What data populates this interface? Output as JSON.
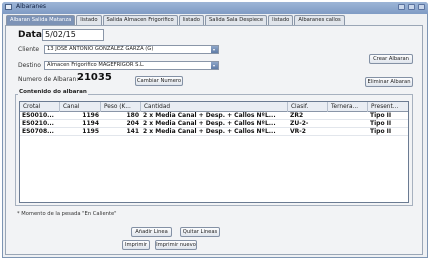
{
  "window": {
    "title": "Albaranes"
  },
  "tabs": [
    {
      "label": "Albaran Salida Matanza"
    },
    {
      "label": "listado"
    },
    {
      "label": "Salida Almacen Frigorifico"
    },
    {
      "label": "listado"
    },
    {
      "label": "Salida Sala Despiece"
    },
    {
      "label": "listado"
    },
    {
      "label": "Albaranes callos"
    }
  ],
  "form": {
    "fecha_label": "Data",
    "fecha_value": "5/02/15",
    "cliente_label": "Cliente",
    "cliente_value": "13 JOSE ANTONIO GONZALEZ GARZA (G)",
    "destino_label": "Destino",
    "destino_value": "Almacen Frigorifico MAGEFRIGOR S.L.",
    "numero_label": "Numero de Albaran:",
    "numero_value": "21035",
    "crear_button": "Crear Albaran",
    "cambiar_button": "Cambiar Numero",
    "eliminar_button": "Eliminar Albaran"
  },
  "contenido": {
    "title": "Contenido do albaran",
    "columns": [
      "Crotal",
      "Canal",
      "Peso (K...",
      "Cantidad",
      "Clasif.",
      "Ternera...",
      "Present..."
    ],
    "rows": [
      [
        "ES0010...",
        "1196",
        "180",
        "2 x Media Canal + Desp. + Callos NºL...",
        "ZR2",
        "",
        "Tipo II"
      ],
      [
        "ES0210...",
        "1194",
        "204",
        "2 x Media Canal + Desp. + Callos NºL...",
        "ZU-2-",
        "",
        "Tipo II"
      ],
      [
        "ES0708...",
        "1195",
        "141",
        "2 x Media Canal + Desp. + Callos NºL...",
        "VR-2",
        "",
        "Tipo II"
      ]
    ]
  },
  "footnote": "* Momento de la pesada \"En Caliente\"",
  "actions": {
    "anadir": "Añadir Linea",
    "quitar": "Quitar Lineas",
    "imprimir": "Imprimir",
    "imprimir_nuevo": "Imprimir nuevo"
  },
  "colors": {
    "title_bar": "#8aa4cc",
    "selected_tab": "#7d93b6",
    "panel": "#f2f3f5"
  }
}
